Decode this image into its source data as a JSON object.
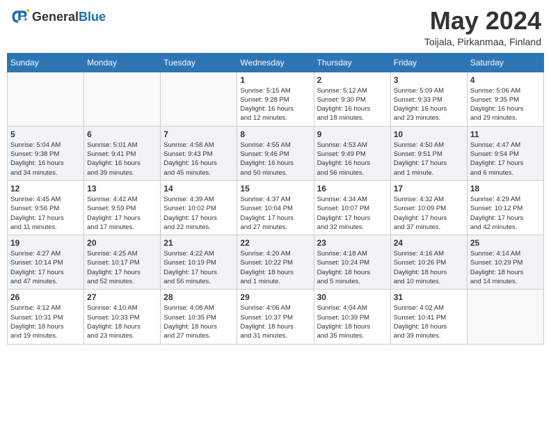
{
  "logo": {
    "general": "General",
    "blue": "Blue"
  },
  "title": "May 2024",
  "location": "Toijala, Pirkanmaa, Finland",
  "weekdays": [
    "Sunday",
    "Monday",
    "Tuesday",
    "Wednesday",
    "Thursday",
    "Friday",
    "Saturday"
  ],
  "weeks": [
    [
      {
        "day": "",
        "info": ""
      },
      {
        "day": "",
        "info": ""
      },
      {
        "day": "",
        "info": ""
      },
      {
        "day": "1",
        "info": "Sunrise: 5:15 AM\nSunset: 9:28 PM\nDaylight: 16 hours\nand 12 minutes."
      },
      {
        "day": "2",
        "info": "Sunrise: 5:12 AM\nSunset: 9:30 PM\nDaylight: 16 hours\nand 18 minutes."
      },
      {
        "day": "3",
        "info": "Sunrise: 5:09 AM\nSunset: 9:33 PM\nDaylight: 16 hours\nand 23 minutes."
      },
      {
        "day": "4",
        "info": "Sunrise: 5:06 AM\nSunset: 9:35 PM\nDaylight: 16 hours\nand 29 minutes."
      }
    ],
    [
      {
        "day": "5",
        "info": "Sunrise: 5:04 AM\nSunset: 9:38 PM\nDaylight: 16 hours\nand 34 minutes."
      },
      {
        "day": "6",
        "info": "Sunrise: 5:01 AM\nSunset: 9:41 PM\nDaylight: 16 hours\nand 39 minutes."
      },
      {
        "day": "7",
        "info": "Sunrise: 4:58 AM\nSunset: 9:43 PM\nDaylight: 16 hours\nand 45 minutes."
      },
      {
        "day": "8",
        "info": "Sunrise: 4:55 AM\nSunset: 9:46 PM\nDaylight: 16 hours\nand 50 minutes."
      },
      {
        "day": "9",
        "info": "Sunrise: 4:53 AM\nSunset: 9:49 PM\nDaylight: 16 hours\nand 56 minutes."
      },
      {
        "day": "10",
        "info": "Sunrise: 4:50 AM\nSunset: 9:51 PM\nDaylight: 17 hours\nand 1 minute."
      },
      {
        "day": "11",
        "info": "Sunrise: 4:47 AM\nSunset: 9:54 PM\nDaylight: 17 hours\nand 6 minutes."
      }
    ],
    [
      {
        "day": "12",
        "info": "Sunrise: 4:45 AM\nSunset: 9:56 PM\nDaylight: 17 hours\nand 11 minutes."
      },
      {
        "day": "13",
        "info": "Sunrise: 4:42 AM\nSunset: 9:59 PM\nDaylight: 17 hours\nand 17 minutes."
      },
      {
        "day": "14",
        "info": "Sunrise: 4:39 AM\nSunset: 10:02 PM\nDaylight: 17 hours\nand 22 minutes."
      },
      {
        "day": "15",
        "info": "Sunrise: 4:37 AM\nSunset: 10:04 PM\nDaylight: 17 hours\nand 27 minutes."
      },
      {
        "day": "16",
        "info": "Sunrise: 4:34 AM\nSunset: 10:07 PM\nDaylight: 17 hours\nand 32 minutes."
      },
      {
        "day": "17",
        "info": "Sunrise: 4:32 AM\nSunset: 10:09 PM\nDaylight: 17 hours\nand 37 minutes."
      },
      {
        "day": "18",
        "info": "Sunrise: 4:29 AM\nSunset: 10:12 PM\nDaylight: 17 hours\nand 42 minutes."
      }
    ],
    [
      {
        "day": "19",
        "info": "Sunrise: 4:27 AM\nSunset: 10:14 PM\nDaylight: 17 hours\nand 47 minutes."
      },
      {
        "day": "20",
        "info": "Sunrise: 4:25 AM\nSunset: 10:17 PM\nDaylight: 17 hours\nand 52 minutes."
      },
      {
        "day": "21",
        "info": "Sunrise: 4:22 AM\nSunset: 10:19 PM\nDaylight: 17 hours\nand 56 minutes."
      },
      {
        "day": "22",
        "info": "Sunrise: 4:20 AM\nSunset: 10:22 PM\nDaylight: 18 hours\nand 1 minute."
      },
      {
        "day": "23",
        "info": "Sunrise: 4:18 AM\nSunset: 10:24 PM\nDaylight: 18 hours\nand 5 minutes."
      },
      {
        "day": "24",
        "info": "Sunrise: 4:16 AM\nSunset: 10:26 PM\nDaylight: 18 hours\nand 10 minutes."
      },
      {
        "day": "25",
        "info": "Sunrise: 4:14 AM\nSunset: 10:29 PM\nDaylight: 18 hours\nand 14 minutes."
      }
    ],
    [
      {
        "day": "26",
        "info": "Sunrise: 4:12 AM\nSunset: 10:31 PM\nDaylight: 18 hours\nand 19 minutes."
      },
      {
        "day": "27",
        "info": "Sunrise: 4:10 AM\nSunset: 10:33 PM\nDaylight: 18 hours\nand 23 minutes."
      },
      {
        "day": "28",
        "info": "Sunrise: 4:08 AM\nSunset: 10:35 PM\nDaylight: 18 hours\nand 27 minutes."
      },
      {
        "day": "29",
        "info": "Sunrise: 4:06 AM\nSunset: 10:37 PM\nDaylight: 18 hours\nand 31 minutes."
      },
      {
        "day": "30",
        "info": "Sunrise: 4:04 AM\nSunset: 10:39 PM\nDaylight: 18 hours\nand 35 minutes."
      },
      {
        "day": "31",
        "info": "Sunrise: 4:02 AM\nSunset: 10:41 PM\nDaylight: 18 hours\nand 39 minutes."
      },
      {
        "day": "",
        "info": ""
      }
    ]
  ]
}
